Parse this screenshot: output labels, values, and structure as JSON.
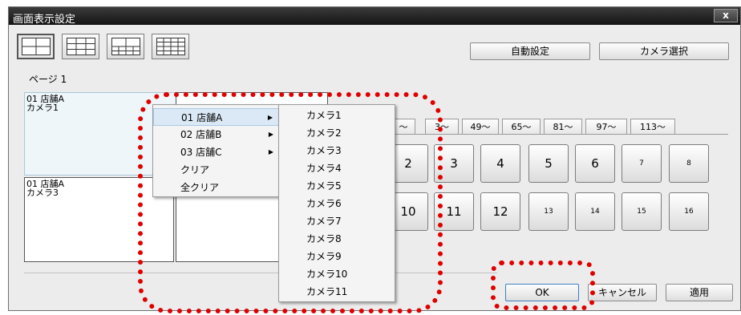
{
  "window": {
    "title": "画面表示設定",
    "close_label": "x"
  },
  "layout_buttons": [
    {
      "name": "layout-4-button",
      "icon": "grid-2x2-icon",
      "selected": true
    },
    {
      "name": "layout-9-button",
      "icon": "grid-3x3-icon",
      "selected": false
    },
    {
      "name": "layout-10-button",
      "icon": "grid-mixed-icon",
      "selected": false
    },
    {
      "name": "layout-16-button",
      "icon": "grid-4x4-icon",
      "selected": false
    }
  ],
  "toolbar": {
    "auto_setting": "自動設定",
    "camera_select": "カメラ選択"
  },
  "page_label": "ページ 1",
  "panels": [
    {
      "line1": "01 店舗A",
      "line2": "カメラ1"
    },
    {
      "line1": "01 店舗A",
      "line2": "カメラ3"
    }
  ],
  "tabs": [
    "〜",
    "3〜",
    "49〜",
    "65〜",
    "81〜",
    "97〜",
    "113〜"
  ],
  "camera_buttons": [
    "2",
    "3",
    "4",
    "5",
    "6",
    "7",
    "8",
    "10",
    "11",
    "12",
    "13",
    "14",
    "15",
    "16"
  ],
  "context_menu": {
    "items": [
      "01 店舗A",
      "02 店舗B",
      "03 店舗C",
      "クリア",
      "全クリア"
    ],
    "submenu_arrow": "▶"
  },
  "camera_submenu": {
    "items": [
      "カメラ1",
      "カメラ2",
      "カメラ3",
      "カメラ4",
      "カメラ5",
      "カメラ6",
      "カメラ7",
      "カメラ8",
      "カメラ9",
      "カメラ10",
      "カメラ11"
    ]
  },
  "footer": {
    "ok": "OK",
    "cancel": "キャンセル",
    "apply": "適用"
  },
  "colors": {
    "highlight": "#e00000",
    "titlebar": "#1e1e1e",
    "menu_hover": "#dbe9f6"
  }
}
